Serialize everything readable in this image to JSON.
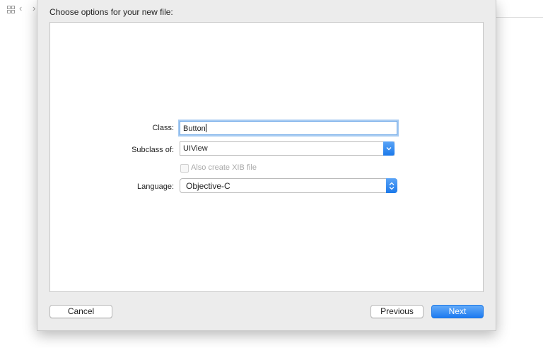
{
  "toolbar": {
    "icons": [
      "grid-icon",
      "chevron-left-icon",
      "chevron-right-icon"
    ]
  },
  "sheet": {
    "title": "Choose options for your new file:"
  },
  "form": {
    "class_label": "Class:",
    "class_value": "Button",
    "subclass_label": "Subclass of:",
    "subclass_value": "UIView",
    "xib_label": "Also create XIB file",
    "xib_checked": false,
    "xib_enabled": false,
    "language_label": "Language:",
    "language_value": "Objective-C"
  },
  "buttons": {
    "cancel": "Cancel",
    "previous": "Previous",
    "next": "Next"
  },
  "colors": {
    "accent": "#1d7af0",
    "focus_ring": "#a7cbf2",
    "disabled_text": "#a9a9a9"
  }
}
